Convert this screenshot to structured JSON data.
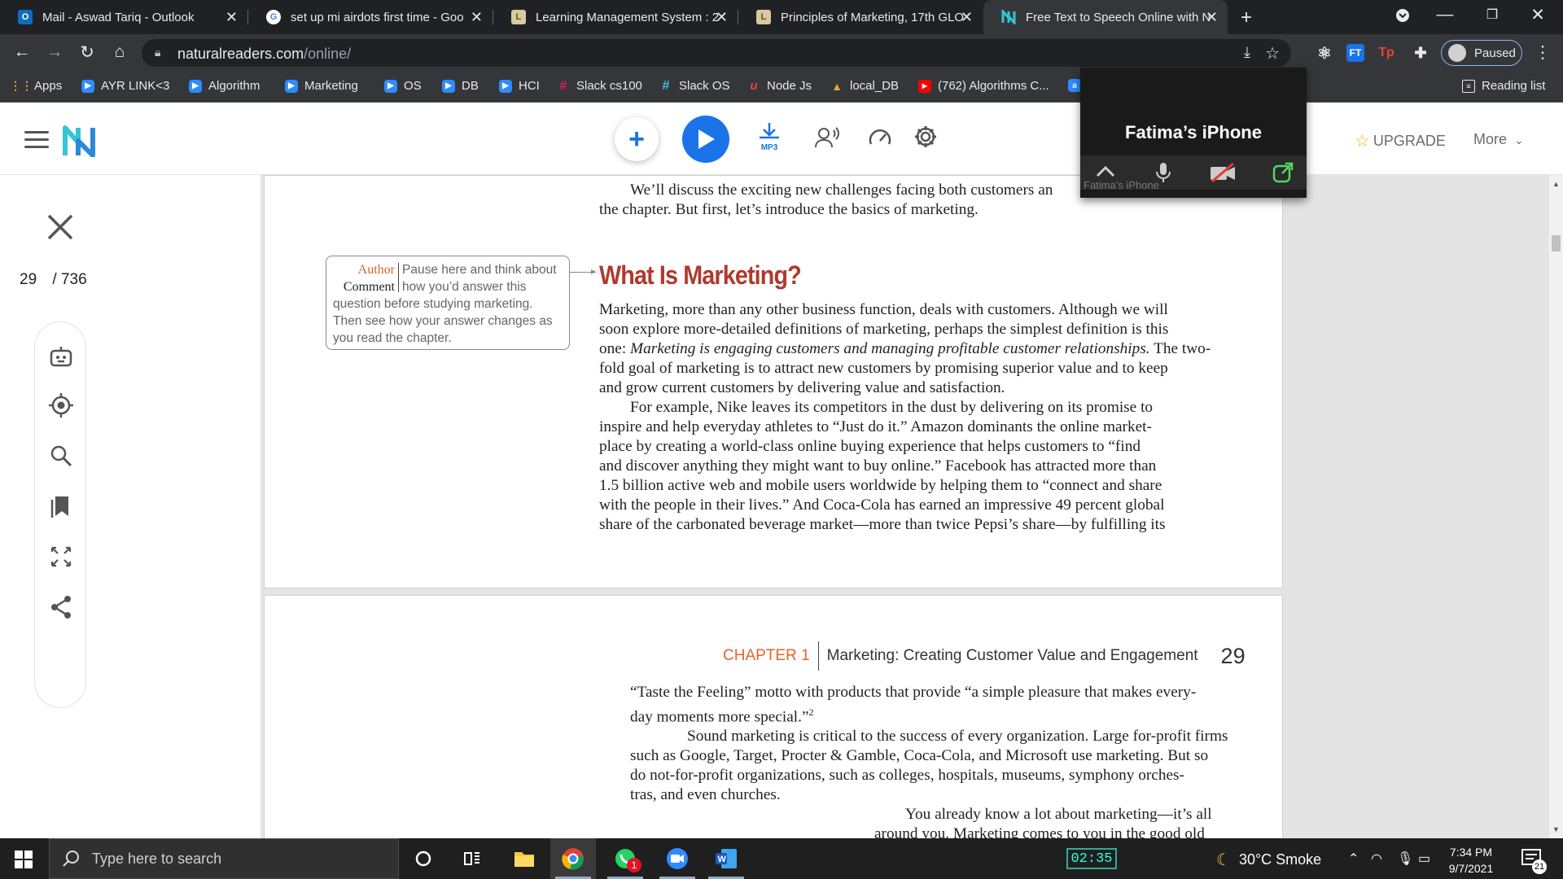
{
  "browser": {
    "tabs": [
      {
        "title": "Mail - Aswad Tariq - Outlook",
        "icon": "outlook-icon",
        "active": false
      },
      {
        "title": "set up mi airdots first time - Goo",
        "icon": "google-icon",
        "active": false
      },
      {
        "title": "Learning Management System : 2",
        "icon": "lms-icon",
        "active": false
      },
      {
        "title": "Principles of Marketing, 17th GLO",
        "icon": "lms-icon",
        "active": false
      },
      {
        "title": "Free Text to Speech Online with N",
        "icon": "naturalreader-icon",
        "active": true
      }
    ],
    "url_domain": "naturalreaders.com",
    "url_path": "/online/",
    "profile_status": "Paused",
    "bookmarks": [
      {
        "label": "Apps",
        "icon": "apps-grid-icon"
      },
      {
        "label": "AYR LINK<3",
        "icon": "zoom-icon"
      },
      {
        "label": "Algorithm",
        "icon": "zoom-icon"
      },
      {
        "label": "Marketing",
        "icon": "zoom-icon"
      },
      {
        "label": "OS",
        "icon": "zoom-icon"
      },
      {
        "label": "DB",
        "icon": "zoom-icon"
      },
      {
        "label": "HCI",
        "icon": "zoom-icon"
      },
      {
        "label": "Slack cs100",
        "icon": "slack-icon"
      },
      {
        "label": "Slack OS",
        "icon": "slack-icon"
      },
      {
        "label": "Node Js",
        "icon": "node-icon"
      },
      {
        "label": "local_DB",
        "icon": "db-icon"
      },
      {
        "label": "(762) Algorithms C...",
        "icon": "youtube-icon"
      }
    ],
    "reading_list": "Reading list"
  },
  "app": {
    "upgrade_label": "UPGRADE",
    "more_label": "More",
    "mp3_label": "MP3",
    "page_current": "29",
    "page_total": "/ 736"
  },
  "document": {
    "p1_l1": "We’ll discuss the exciting new challenges facing both customers an",
    "p1_l2": "the chapter. But first, let’s introduce the basics of marketing.",
    "heading": "What Is Marketing?",
    "author_label_1": "Author",
    "author_label_2": "Comment",
    "author_l1": "Pause here and think about",
    "author_l2": "how you’d answer this",
    "author_l3": "question before studying marketing.",
    "author_l4": "Then see how your answer changes as",
    "author_l5": "you read the chapter.",
    "body": [
      "Marketing, more than any other business function, deals with customers. Although we will",
      "soon explore more-detailed definitions of marketing, perhaps the simplest definition is this",
      "one: Marketing is engaging customers and managing profitable customer relationships. The two-",
      "fold goal of marketing is to attract new customers by promising superior value and to keep",
      "and grow current customers by delivering value and satisfaction.",
      "For example, Nike leaves its competitors in the dust by delivering on its promise to",
      "inspire and help everyday athletes to “Just do it.” Amazon dominants the online market-",
      "place by creating a world-class online buying experience that helps customers to “find",
      "and discover anything they might want to buy online.” Facebook has attracted more than",
      "1.5 billion active web and mobile users worldwide by helping them to “connect and share",
      "with the people in their lives.” And Coca-Cola has earned an impressive 49 percent global",
      "share of the carbonated beverage market—more than twice Pepsi’s share—by fulfilling its"
    ],
    "chapter_label": "CHAPTER 1",
    "chapter_title": "Marketing: Creating Customer Value and Engagement",
    "page_number": "29",
    "page2": [
      "“Taste the Feeling” motto with products that provide “a simple pleasure that makes every-",
      "day moments more special.”",
      "Sound marketing is critical to the success of every organization. Large for-profit firms",
      "such as Google, Target, Procter & Gamble, Coca-Cola, and Microsoft use marketing. But so",
      "do not-for-profit organizations, such as colleges, hospitals, museums, symphony orches-",
      "tras, and even churches.",
      "You already know a lot about marketing—it’s all",
      "around you. Marketing comes to you in the good old"
    ],
    "footnote": "2"
  },
  "zoom_overlay": {
    "name": "Fatima’s iPhone",
    "sub": "Fatima’s iPhone"
  },
  "taskbar": {
    "search_placeholder": "Type here to search",
    "timer": "02:35",
    "weather": "30°C  Smoke",
    "time": "7:34 PM",
    "date": "9/7/2021",
    "whatsapp_badge": "1",
    "notification_count": "21"
  }
}
